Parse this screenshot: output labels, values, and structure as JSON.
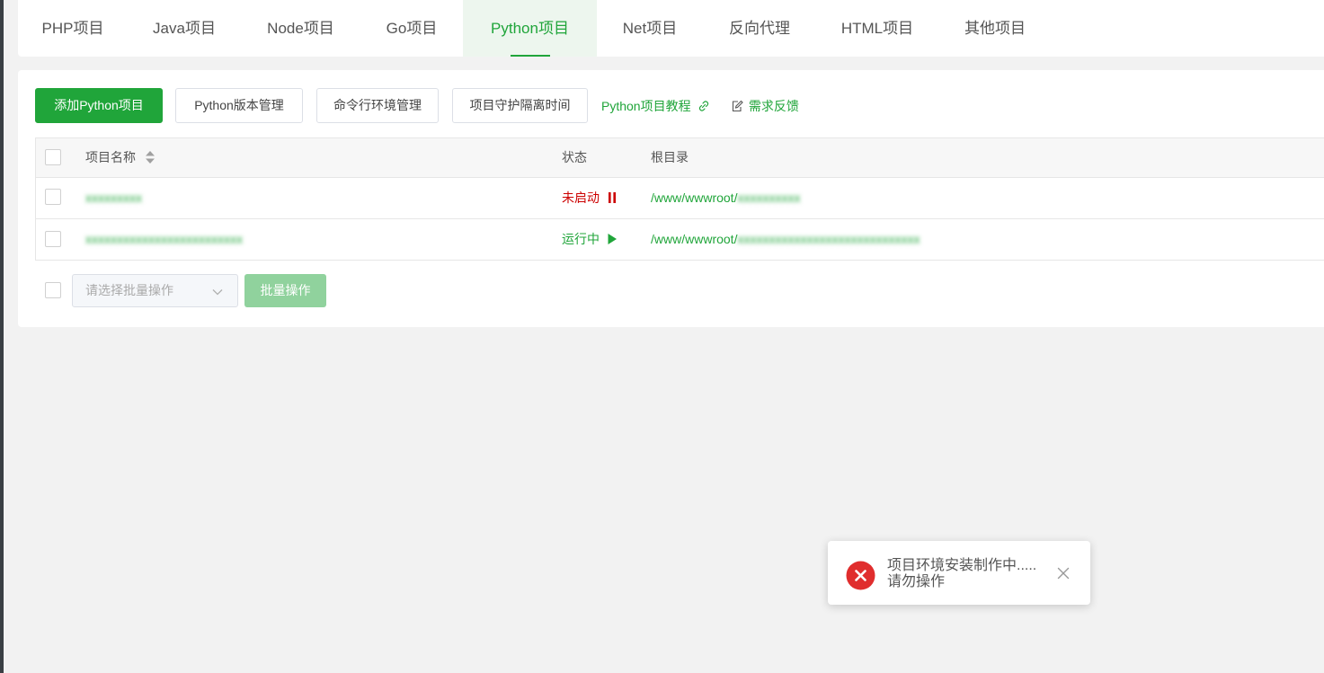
{
  "tabs": [
    {
      "label": "PHP项目"
    },
    {
      "label": "Java项目"
    },
    {
      "label": "Node项目"
    },
    {
      "label": "Go项目"
    },
    {
      "label": "Python项目"
    },
    {
      "label": "Net项目"
    },
    {
      "label": "反向代理"
    },
    {
      "label": "HTML项目"
    },
    {
      "label": "其他项目"
    }
  ],
  "active_tab": "Python项目",
  "toolbar": {
    "add_label": "添加Python项目",
    "version_label": "Python版本管理",
    "cmd_env_label": "命令行环境管理",
    "guard_label": "项目守护隔离时间",
    "tutorial_label": "Python项目教程",
    "feedback_label": "需求反馈"
  },
  "table": {
    "headers": {
      "name": "项目名称",
      "status": "状态",
      "root": "根目录"
    },
    "rows": [
      {
        "name": "xxxxxxxxx",
        "status": "未启动",
        "root_prefix": "/www/wwwroot/",
        "root_blur": "xxxxxxxxxx"
      },
      {
        "name": "xxxxxxxxxxxxxxxxxxxxxxxxx",
        "status": "运行中",
        "root_prefix": "/www/wwwroot/",
        "root_blur": "xxxxxxxxxxxxxxxxxxxxxxxxxxxxx"
      }
    ]
  },
  "batch": {
    "select_placeholder": "请选择批量操作",
    "button_label": "批量操作"
  },
  "toast": {
    "line1": "项目环境安装制作中.....",
    "line2": "请勿操作"
  },
  "colors": {
    "accent": "#20a53a",
    "stopped": "#cc0000",
    "error": "#e02d2d"
  }
}
